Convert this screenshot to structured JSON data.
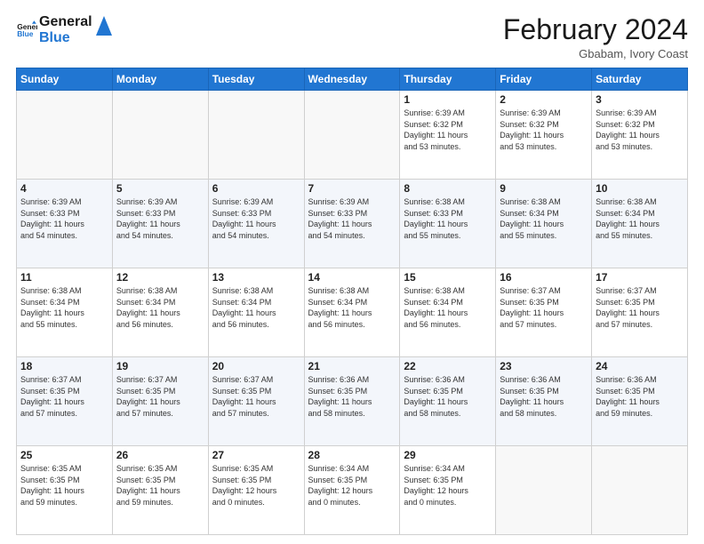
{
  "header": {
    "logo_line1": "General",
    "logo_line2": "Blue",
    "month_title": "February 2024",
    "location": "Gbabam, Ivory Coast"
  },
  "days_of_week": [
    "Sunday",
    "Monday",
    "Tuesday",
    "Wednesday",
    "Thursday",
    "Friday",
    "Saturday"
  ],
  "weeks": [
    [
      {
        "day": "",
        "info": ""
      },
      {
        "day": "",
        "info": ""
      },
      {
        "day": "",
        "info": ""
      },
      {
        "day": "",
        "info": ""
      },
      {
        "day": "1",
        "info": "Sunrise: 6:39 AM\nSunset: 6:32 PM\nDaylight: 11 hours\nand 53 minutes."
      },
      {
        "day": "2",
        "info": "Sunrise: 6:39 AM\nSunset: 6:32 PM\nDaylight: 11 hours\nand 53 minutes."
      },
      {
        "day": "3",
        "info": "Sunrise: 6:39 AM\nSunset: 6:32 PM\nDaylight: 11 hours\nand 53 minutes."
      }
    ],
    [
      {
        "day": "4",
        "info": "Sunrise: 6:39 AM\nSunset: 6:33 PM\nDaylight: 11 hours\nand 54 minutes."
      },
      {
        "day": "5",
        "info": "Sunrise: 6:39 AM\nSunset: 6:33 PM\nDaylight: 11 hours\nand 54 minutes."
      },
      {
        "day": "6",
        "info": "Sunrise: 6:39 AM\nSunset: 6:33 PM\nDaylight: 11 hours\nand 54 minutes."
      },
      {
        "day": "7",
        "info": "Sunrise: 6:39 AM\nSunset: 6:33 PM\nDaylight: 11 hours\nand 54 minutes."
      },
      {
        "day": "8",
        "info": "Sunrise: 6:38 AM\nSunset: 6:33 PM\nDaylight: 11 hours\nand 55 minutes."
      },
      {
        "day": "9",
        "info": "Sunrise: 6:38 AM\nSunset: 6:34 PM\nDaylight: 11 hours\nand 55 minutes."
      },
      {
        "day": "10",
        "info": "Sunrise: 6:38 AM\nSunset: 6:34 PM\nDaylight: 11 hours\nand 55 minutes."
      }
    ],
    [
      {
        "day": "11",
        "info": "Sunrise: 6:38 AM\nSunset: 6:34 PM\nDaylight: 11 hours\nand 55 minutes."
      },
      {
        "day": "12",
        "info": "Sunrise: 6:38 AM\nSunset: 6:34 PM\nDaylight: 11 hours\nand 56 minutes."
      },
      {
        "day": "13",
        "info": "Sunrise: 6:38 AM\nSunset: 6:34 PM\nDaylight: 11 hours\nand 56 minutes."
      },
      {
        "day": "14",
        "info": "Sunrise: 6:38 AM\nSunset: 6:34 PM\nDaylight: 11 hours\nand 56 minutes."
      },
      {
        "day": "15",
        "info": "Sunrise: 6:38 AM\nSunset: 6:34 PM\nDaylight: 11 hours\nand 56 minutes."
      },
      {
        "day": "16",
        "info": "Sunrise: 6:37 AM\nSunset: 6:35 PM\nDaylight: 11 hours\nand 57 minutes."
      },
      {
        "day": "17",
        "info": "Sunrise: 6:37 AM\nSunset: 6:35 PM\nDaylight: 11 hours\nand 57 minutes."
      }
    ],
    [
      {
        "day": "18",
        "info": "Sunrise: 6:37 AM\nSunset: 6:35 PM\nDaylight: 11 hours\nand 57 minutes."
      },
      {
        "day": "19",
        "info": "Sunrise: 6:37 AM\nSunset: 6:35 PM\nDaylight: 11 hours\nand 57 minutes."
      },
      {
        "day": "20",
        "info": "Sunrise: 6:37 AM\nSunset: 6:35 PM\nDaylight: 11 hours\nand 57 minutes."
      },
      {
        "day": "21",
        "info": "Sunrise: 6:36 AM\nSunset: 6:35 PM\nDaylight: 11 hours\nand 58 minutes."
      },
      {
        "day": "22",
        "info": "Sunrise: 6:36 AM\nSunset: 6:35 PM\nDaylight: 11 hours\nand 58 minutes."
      },
      {
        "day": "23",
        "info": "Sunrise: 6:36 AM\nSunset: 6:35 PM\nDaylight: 11 hours\nand 58 minutes."
      },
      {
        "day": "24",
        "info": "Sunrise: 6:36 AM\nSunset: 6:35 PM\nDaylight: 11 hours\nand 59 minutes."
      }
    ],
    [
      {
        "day": "25",
        "info": "Sunrise: 6:35 AM\nSunset: 6:35 PM\nDaylight: 11 hours\nand 59 minutes."
      },
      {
        "day": "26",
        "info": "Sunrise: 6:35 AM\nSunset: 6:35 PM\nDaylight: 11 hours\nand 59 minutes."
      },
      {
        "day": "27",
        "info": "Sunrise: 6:35 AM\nSunset: 6:35 PM\nDaylight: 12 hours\nand 0 minutes."
      },
      {
        "day": "28",
        "info": "Sunrise: 6:34 AM\nSunset: 6:35 PM\nDaylight: 12 hours\nand 0 minutes."
      },
      {
        "day": "29",
        "info": "Sunrise: 6:34 AM\nSunset: 6:35 PM\nDaylight: 12 hours\nand 0 minutes."
      },
      {
        "day": "",
        "info": ""
      },
      {
        "day": "",
        "info": ""
      }
    ]
  ]
}
